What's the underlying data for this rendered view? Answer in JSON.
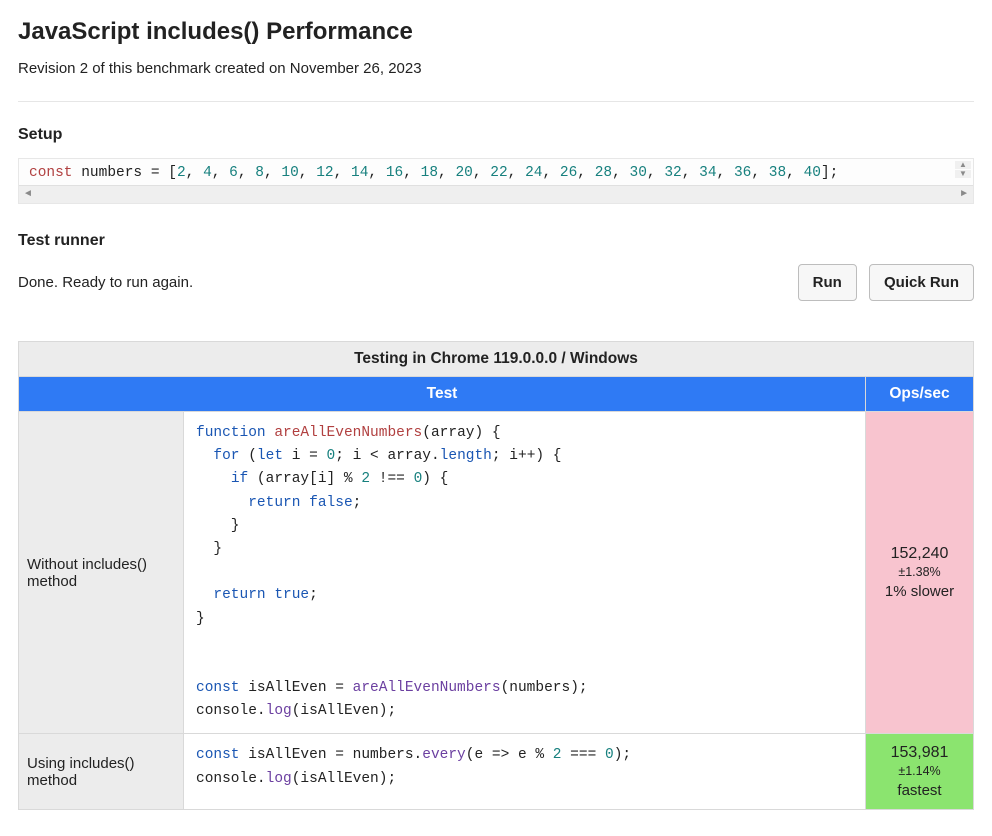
{
  "title": "JavaScript includes() Performance",
  "meta": "Revision 2 of this benchmark created on November 26, 2023",
  "sections": {
    "setup": "Setup",
    "runner": "Test runner"
  },
  "setup_code_tokens": [
    {
      "t": "const ",
      "c": "cnst"
    },
    {
      "t": "numbers ",
      "c": "id"
    },
    {
      "t": "= [",
      "c": "op"
    },
    {
      "t": "2",
      "c": "num"
    },
    {
      "t": ", ",
      "c": "op"
    },
    {
      "t": "4",
      "c": "num"
    },
    {
      "t": ", ",
      "c": "op"
    },
    {
      "t": "6",
      "c": "num"
    },
    {
      "t": ", ",
      "c": "op"
    },
    {
      "t": "8",
      "c": "num"
    },
    {
      "t": ", ",
      "c": "op"
    },
    {
      "t": "10",
      "c": "num"
    },
    {
      "t": ", ",
      "c": "op"
    },
    {
      "t": "12",
      "c": "num"
    },
    {
      "t": ", ",
      "c": "op"
    },
    {
      "t": "14",
      "c": "num"
    },
    {
      "t": ", ",
      "c": "op"
    },
    {
      "t": "16",
      "c": "num"
    },
    {
      "t": ", ",
      "c": "op"
    },
    {
      "t": "18",
      "c": "num"
    },
    {
      "t": ", ",
      "c": "op"
    },
    {
      "t": "20",
      "c": "num"
    },
    {
      "t": ", ",
      "c": "op"
    },
    {
      "t": "22",
      "c": "num"
    },
    {
      "t": ", ",
      "c": "op"
    },
    {
      "t": "24",
      "c": "num"
    },
    {
      "t": ", ",
      "c": "op"
    },
    {
      "t": "26",
      "c": "num"
    },
    {
      "t": ", ",
      "c": "op"
    },
    {
      "t": "28",
      "c": "num"
    },
    {
      "t": ", ",
      "c": "op"
    },
    {
      "t": "30",
      "c": "num"
    },
    {
      "t": ", ",
      "c": "op"
    },
    {
      "t": "32",
      "c": "num"
    },
    {
      "t": ", ",
      "c": "op"
    },
    {
      "t": "34",
      "c": "num"
    },
    {
      "t": ", ",
      "c": "op"
    },
    {
      "t": "36",
      "c": "num"
    },
    {
      "t": ", ",
      "c": "op"
    },
    {
      "t": "38",
      "c": "num"
    },
    {
      "t": ", ",
      "c": "op"
    },
    {
      "t": "40",
      "c": "num"
    },
    {
      "t": "];",
      "c": "op"
    }
  ],
  "runner": {
    "status": "Done. Ready to run again.",
    "buttons": {
      "run": "Run",
      "quick": "Quick Run"
    }
  },
  "table": {
    "caption": "Testing in Chrome 119.0.0.0 / Windows",
    "headers": {
      "test": "Test",
      "ops": "Ops/sec"
    },
    "rows": [
      {
        "name": "Without includes() method",
        "ops": {
          "value": "152,240",
          "pm": "±1.38%",
          "tag": "1% slower",
          "class": "slower"
        },
        "code_tokens": [
          {
            "t": "function ",
            "c": "kw"
          },
          {
            "t": "areAllEvenNumbers",
            "c": "fnname"
          },
          {
            "t": "(array) {",
            "c": "op"
          },
          {
            "nl": 1
          },
          {
            "t": "  ",
            "c": "op"
          },
          {
            "t": "for ",
            "c": "kw"
          },
          {
            "t": "(",
            "c": "op"
          },
          {
            "t": "let ",
            "c": "kw"
          },
          {
            "t": "i = ",
            "c": "id"
          },
          {
            "t": "0",
            "c": "num"
          },
          {
            "t": "; i < array.",
            "c": "op"
          },
          {
            "t": "length",
            "c": "prop"
          },
          {
            "t": "; i++) {",
            "c": "op"
          },
          {
            "nl": 1
          },
          {
            "t": "    ",
            "c": "op"
          },
          {
            "t": "if ",
            "c": "kw"
          },
          {
            "t": "(array[i] % ",
            "c": "op"
          },
          {
            "t": "2",
            "c": "num"
          },
          {
            "t": " !== ",
            "c": "op"
          },
          {
            "t": "0",
            "c": "num"
          },
          {
            "t": ") {",
            "c": "op"
          },
          {
            "nl": 1
          },
          {
            "t": "      ",
            "c": "op"
          },
          {
            "t": "return ",
            "c": "kw"
          },
          {
            "t": "false",
            "c": "bool"
          },
          {
            "t": ";",
            "c": "op"
          },
          {
            "nl": 1
          },
          {
            "t": "    }",
            "c": "op"
          },
          {
            "nl": 1
          },
          {
            "t": "  }",
            "c": "op"
          },
          {
            "nl": 1
          },
          {
            "nl": 1
          },
          {
            "t": "  ",
            "c": "op"
          },
          {
            "t": "return ",
            "c": "kw"
          },
          {
            "t": "true",
            "c": "bool"
          },
          {
            "t": ";",
            "c": "op"
          },
          {
            "nl": 1
          },
          {
            "t": "}",
            "c": "op"
          },
          {
            "nl": 1
          },
          {
            "nl": 1
          },
          {
            "nl": 1
          },
          {
            "t": "const ",
            "c": "kw"
          },
          {
            "t": "isAllEven = ",
            "c": "id"
          },
          {
            "t": "areAllEvenNumbers",
            "c": "call"
          },
          {
            "t": "(numbers);",
            "c": "op"
          },
          {
            "nl": 1
          },
          {
            "t": "console.",
            "c": "id"
          },
          {
            "t": "log",
            "c": "call"
          },
          {
            "t": "(isAllEven);",
            "c": "op"
          }
        ]
      },
      {
        "name": "Using includes() method",
        "ops": {
          "value": "153,981",
          "pm": "±1.14%",
          "tag": "fastest",
          "class": "fastest"
        },
        "code_tokens": [
          {
            "t": "const ",
            "c": "kw"
          },
          {
            "t": "isAllEven = numbers.",
            "c": "id"
          },
          {
            "t": "every",
            "c": "call"
          },
          {
            "t": "(e => e % ",
            "c": "op"
          },
          {
            "t": "2",
            "c": "num"
          },
          {
            "t": " === ",
            "c": "op"
          },
          {
            "t": "0",
            "c": "num"
          },
          {
            "t": ");",
            "c": "op"
          },
          {
            "nl": 1
          },
          {
            "t": "console.",
            "c": "id"
          },
          {
            "t": "log",
            "c": "call"
          },
          {
            "t": "(isAllEven);",
            "c": "op"
          }
        ]
      }
    ]
  }
}
